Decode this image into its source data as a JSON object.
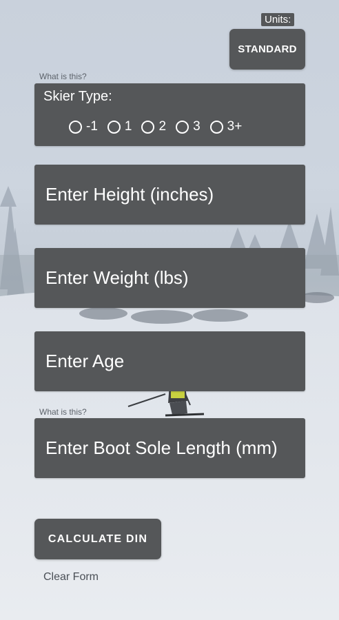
{
  "units": {
    "label": "Units:",
    "button": "STANDARD"
  },
  "skier_type": {
    "hint": "What is this?",
    "title": "Skier Type:",
    "options": [
      "-1",
      "1",
      "2",
      "3",
      "3+"
    ]
  },
  "fields": {
    "height_placeholder": "Enter Height (inches)",
    "weight_placeholder": "Enter Weight (lbs)",
    "age_placeholder": "Enter Age",
    "bsl_hint": "What is this?",
    "bsl_placeholder": "Enter Boot Sole Length (mm)"
  },
  "actions": {
    "calculate": "CALCULATE DIN",
    "clear": "Clear Form"
  }
}
